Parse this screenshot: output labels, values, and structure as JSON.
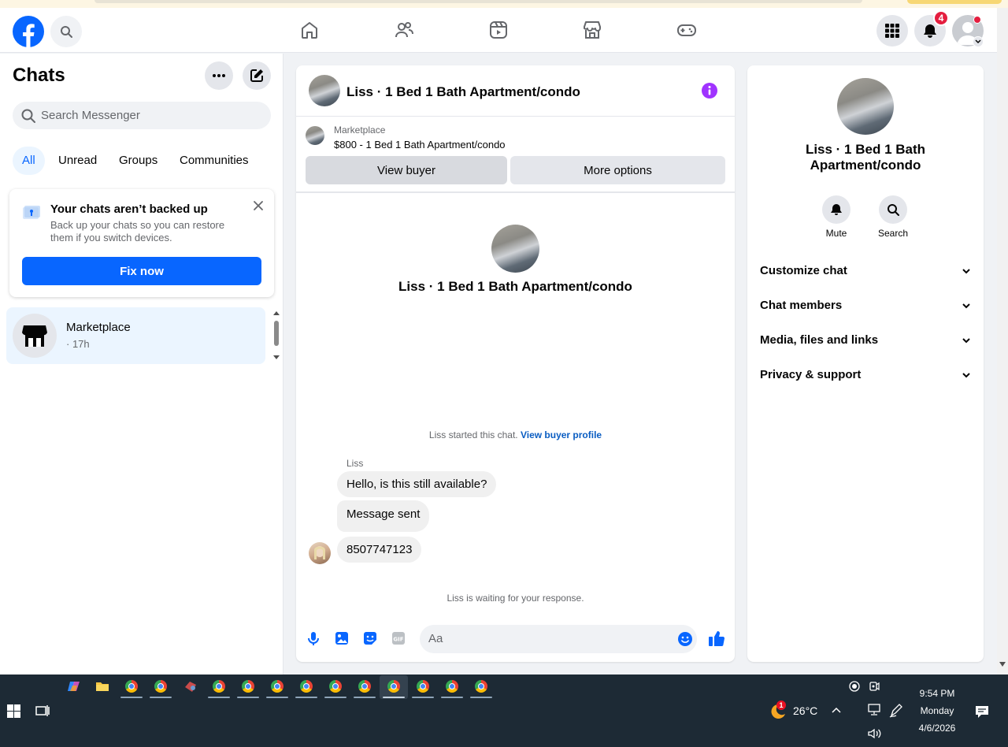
{
  "nav": {
    "notifications_count": "4",
    "brand_color": "#0866ff"
  },
  "left": {
    "title": "Chats",
    "search_placeholder": "Search Messenger",
    "tabs": [
      "All",
      "Unread",
      "Groups",
      "Communities"
    ],
    "backup": {
      "title": "Your chats aren’t backed up",
      "text": "Back up your chats so you can restore them if you switch devices.",
      "button": "Fix now"
    },
    "chats": [
      {
        "name": "Marketplace",
        "time": "· 17h"
      }
    ]
  },
  "chat": {
    "title": "Liss · 1 Bed 1 Bath Apartment/condo",
    "listing_source": "Marketplace",
    "listing_text": "$800 - 1 Bed 1 Bath Apartment/condo",
    "view_buyer": "View buyer",
    "more_options": "More options",
    "intro_name": "Liss · 1 Bed 1 Bath Apartment/condo",
    "started_text": "Liss started this chat.",
    "started_link": "View buyer profile",
    "sender": "Liss",
    "messages": [
      "Hello, is this still available?",
      "Message sent",
      "8507747123"
    ],
    "waiting": "Liss is waiting for your response.",
    "composer_placeholder": "Aa"
  },
  "details": {
    "name": "Liss · 1 Bed 1 Bath Apartment/condo",
    "actions": [
      "Mute",
      "Search"
    ],
    "sections": [
      "Customize chat",
      "Chat members",
      "Media, files and links",
      "Privacy & support"
    ]
  },
  "taskbar": {
    "weather_temp": "26°C",
    "weather_alert": "1",
    "time": "9:54 PM",
    "day": "Monday",
    "date": "4/6/2026"
  }
}
